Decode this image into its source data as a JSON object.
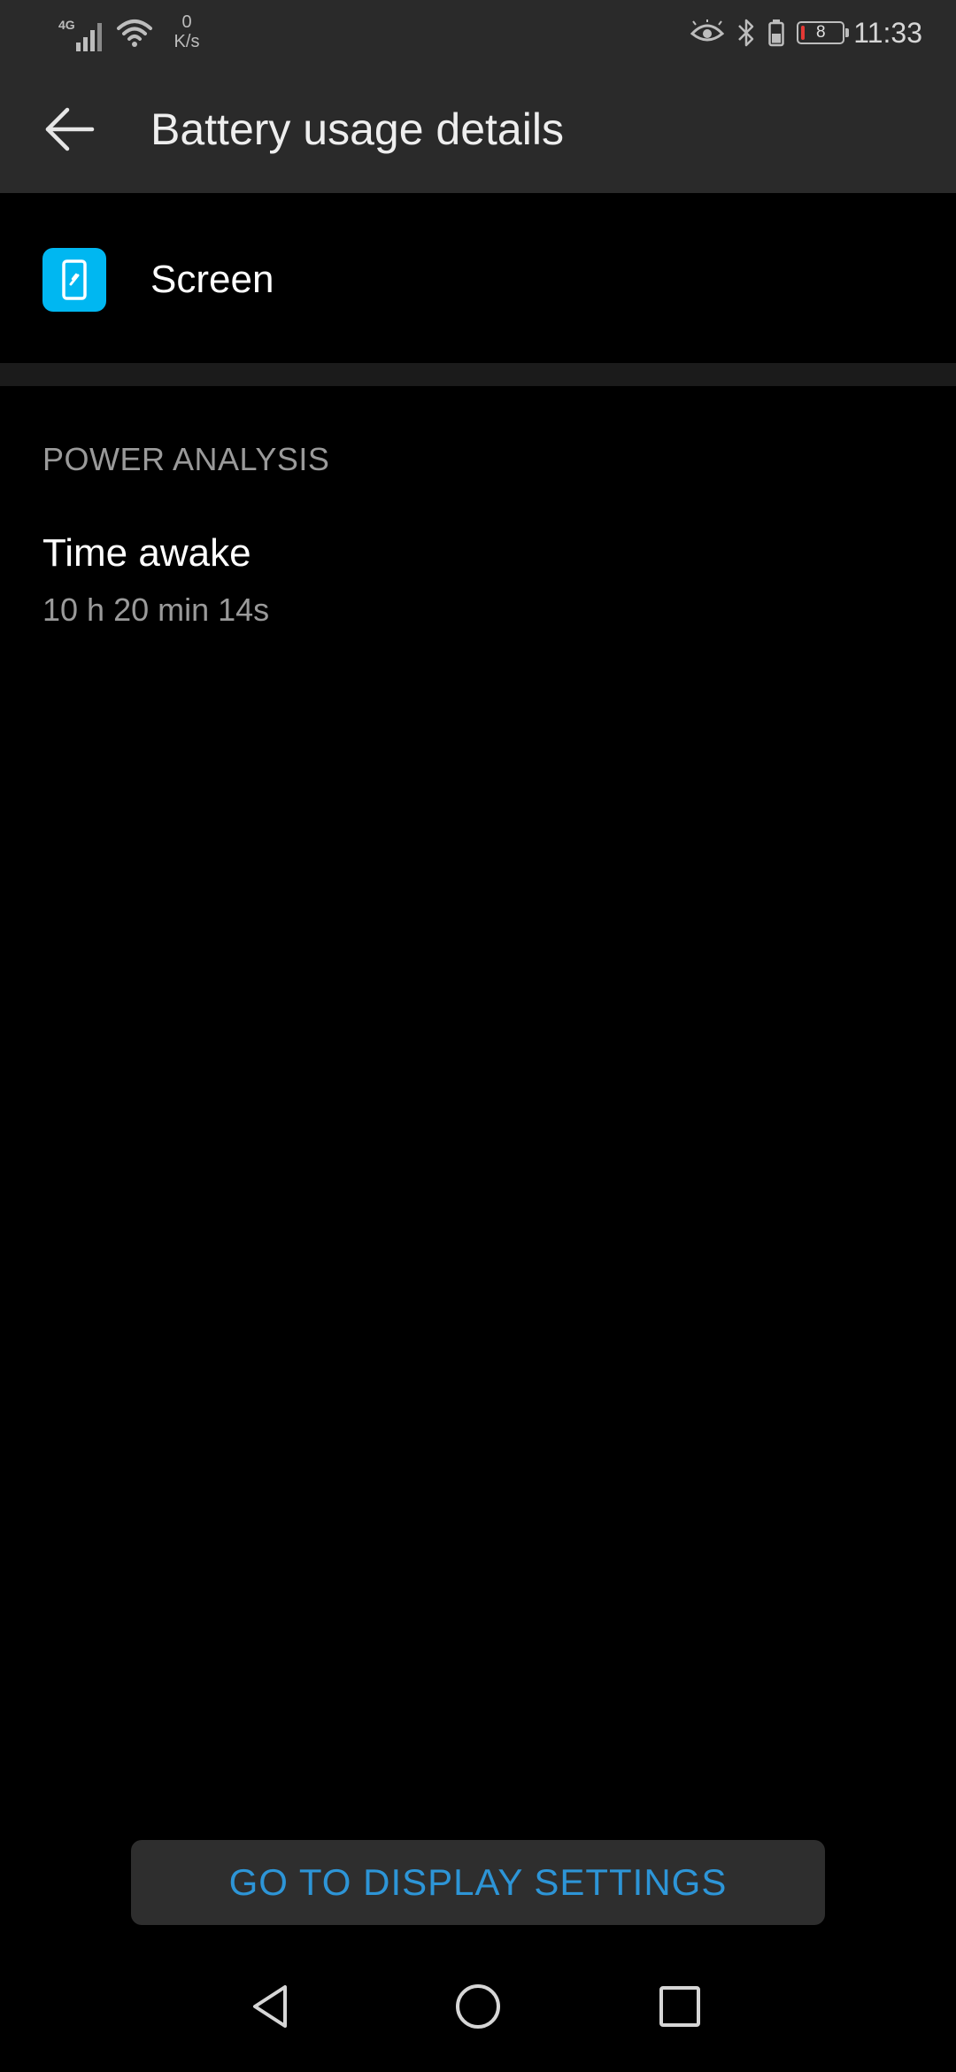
{
  "status_bar": {
    "network_label": "4G",
    "speed_value": "0",
    "speed_unit": "K/s",
    "battery_level": "8",
    "battery_fraction": 0.08,
    "time": "11:33",
    "battery_color": "#e53935",
    "icons": [
      "signal-icon",
      "wifi-icon",
      "eye-icon",
      "bluetooth-icon",
      "headset-battery-icon",
      "battery-icon"
    ]
  },
  "app_bar": {
    "title": "Battery usage details",
    "back_icon": "arrow-left-icon"
  },
  "app": {
    "name": "Screen",
    "icon": "phone-screen-icon",
    "icon_color": "#00b7f1"
  },
  "power_analysis": {
    "header": "POWER ANALYSIS",
    "time_awake_label": "Time awake",
    "time_awake_value": "10 h 20 min 14s"
  },
  "action": {
    "label": "GO TO DISPLAY SETTINGS",
    "color": "#2d95d7"
  },
  "nav": {
    "back_icon": "triangle-back-icon",
    "home_icon": "circle-home-icon",
    "recents_icon": "square-recents-icon"
  }
}
